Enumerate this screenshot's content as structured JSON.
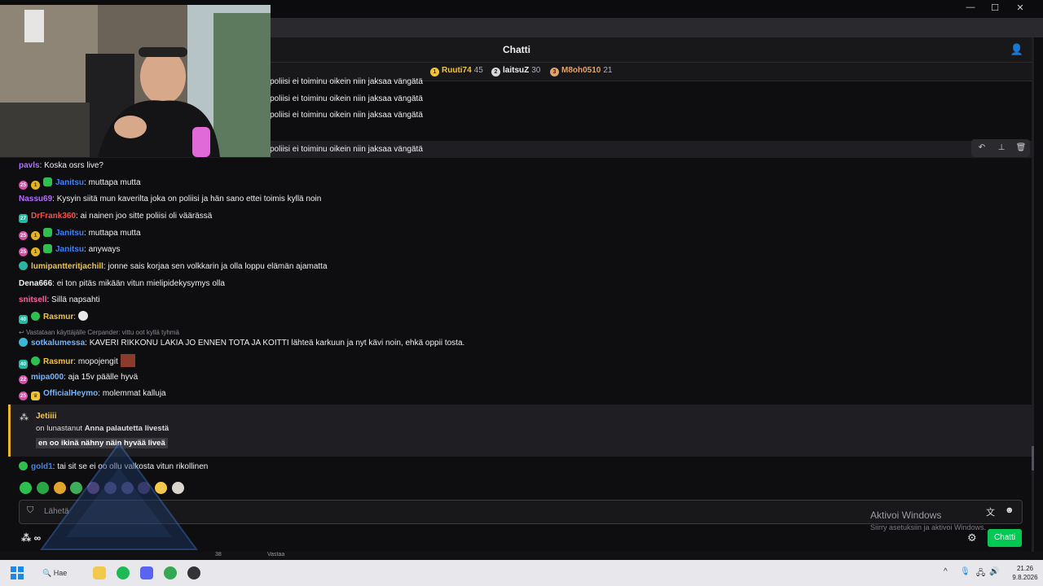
{
  "window": {
    "title": "Chatti",
    "controls": [
      "—",
      "☐",
      "✕"
    ]
  },
  "chat": {
    "header_title": "Chatti",
    "leaderboard": [
      {
        "rank": "1",
        "name": "Ruuti74",
        "score": "45",
        "color": "#f0c43a"
      },
      {
        "rank": "2",
        "name": "laitsuZ",
        "score": "30",
        "color": "#efeff1"
      },
      {
        "rank": "3",
        "name": "M8oh0510",
        "score": "21",
        "color": "#e0a36a"
      }
    ],
    "repeated_messages": [
      "poliisi ei toiminu oikein niin jaksaa vängätä",
      "poliisi ei toiminu oikein niin jaksaa vängätä",
      "poliisi ei toiminu oikein niin jaksaa vängätä",
      "poliisi ei toiminu oikein niin jaksaa vängätä"
    ],
    "messages": [
      {
        "user": "pavls",
        "color": "#b36cff",
        "text": "Koska osrs live?"
      },
      {
        "user": "Janitsu",
        "color": "#3b82f6",
        "text": "muttapa mutta"
      },
      {
        "user": "Nassu69",
        "color": "#b36cff",
        "text": "Kysyin siitä mun kaverilta joka on poliisi ja hän sano ettei toimis kyllä noin"
      },
      {
        "user": "DrFrank360",
        "color": "#ff4a4a",
        "text": "ai nainen joo sitte poliisi oli väärässä"
      },
      {
        "user": "Janitsu",
        "color": "#3b82f6",
        "text": "muttapa mutta"
      },
      {
        "user": "Janitsu",
        "color": "#3b82f6",
        "text": "anyways"
      },
      {
        "user": "lumipantteritjachill",
        "color": "#f0c43a",
        "text": "jonne sais korjaa sen volkkarin ja olla loppu elämän ajamatta"
      },
      {
        "user": "Dena666",
        "color": "#efeff1",
        "text": "ei ton pitäs mikään vitun mielipidekysymys olla"
      },
      {
        "user": "snitsell",
        "color": "#ff5fa2",
        "text": "Sillä napsahti"
      },
      {
        "user": "Rasmur",
        "color": "#f0c43a",
        "text": ""
      },
      {
        "user": "sotkalumessa",
        "color": "#6fb6ff",
        "text": "KAVERI RIKKONU LAKIA JO ENNEN TOTA JA KOITTI lähteä karkuun ja nyt kävi noin, ehkä oppii tosta."
      },
      {
        "user": "Rasmur",
        "color": "#f0c43a",
        "text": "mopojengit"
      },
      {
        "user": "mipa000",
        "color": "#6fb6ff",
        "text": "aja 15v päälle hyvä"
      },
      {
        "user": "OfficialHeymo",
        "color": "#6fb6ff",
        "text": "molemmat kalluja"
      },
      {
        "user": "gold1",
        "color": "#3b82f6",
        "text": "tai sit se ei oo ollu valkosta vitun rikollinen"
      }
    ],
    "reply_hint": "Vastataan käyttäjälle Cerpander: vittu oot kyllä tyhmä",
    "redemption": {
      "user": "Jetiiii",
      "text_prefix": "on lunastanut",
      "reward": "Anna palautetta livestä",
      "message": "en oo ikinä nähny näin hyvää liveä"
    },
    "input_placeholder": "Lähetä",
    "send_button": "Chatti",
    "logo_text": "∞"
  },
  "windows_activation": {
    "title": "Aktivoi Windows",
    "subtitle": "Siirry asetuksiin ja aktivoi Windows."
  },
  "under_strip": {
    "count": "38",
    "reply": "Vastaa"
  },
  "taskbar": {
    "search": "Hae",
    "time": "21.26",
    "date": "9.8.2026"
  }
}
